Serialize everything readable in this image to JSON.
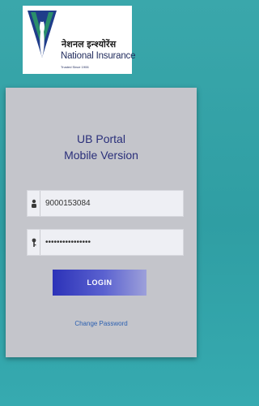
{
  "logo": {
    "hindi_name": "नेशनल इन्श्योरेंस",
    "english_name": "National Insurance",
    "tagline": "Trusted Since 1906",
    "emblem_icon": "peacock-emblem-icon",
    "brand_color": "#1f2a5c"
  },
  "portal": {
    "title_line1": "UB Portal",
    "title_line2": "Mobile Version"
  },
  "form": {
    "username_value": "9000153084",
    "username_icon": "user-icon",
    "password_value": "••••••••••••••••",
    "password_icon": "key-icon",
    "login_label": "LOGIN",
    "change_password_label": "Change Password"
  },
  "colors": {
    "background": "#3aa7ab",
    "card": "#c4c5cb",
    "title": "#2a2f7a",
    "button": "#2c32b8",
    "link": "#2a5fb0"
  }
}
